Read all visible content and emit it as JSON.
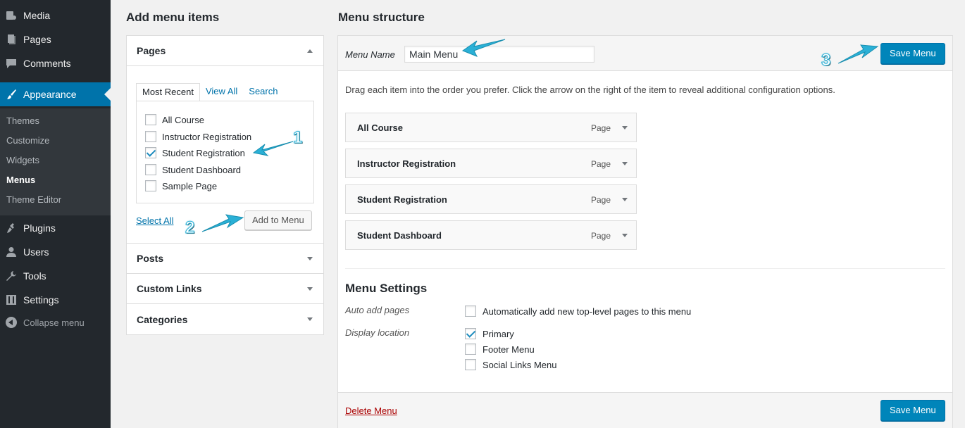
{
  "sidebar": {
    "items": [
      {
        "label": "Media",
        "icon": "media-icon"
      },
      {
        "label": "Pages",
        "icon": "pages-icon"
      },
      {
        "label": "Comments",
        "icon": "comments-icon"
      },
      {
        "label": "Appearance",
        "icon": "appearance-icon"
      },
      {
        "label": "Plugins",
        "icon": "plugins-icon"
      },
      {
        "label": "Users",
        "icon": "users-icon"
      },
      {
        "label": "Tools",
        "icon": "tools-icon"
      },
      {
        "label": "Settings",
        "icon": "settings-icon"
      }
    ],
    "submenu": [
      "Themes",
      "Customize",
      "Widgets",
      "Menus",
      "Theme Editor"
    ],
    "collapse_label": "Collapse menu"
  },
  "add_items": {
    "heading": "Add menu items",
    "pages": {
      "title": "Pages",
      "tabs": [
        "Most Recent",
        "View All",
        "Search"
      ],
      "items": [
        {
          "label": "All Course",
          "checked": false
        },
        {
          "label": "Instructor Registration",
          "checked": false
        },
        {
          "label": "Student Registration",
          "checked": true
        },
        {
          "label": "Student Dashboard",
          "checked": false
        },
        {
          "label": "Sample Page",
          "checked": false
        }
      ],
      "select_all": "Select All",
      "add_button": "Add to Menu"
    },
    "sections": [
      "Posts",
      "Custom Links",
      "Categories"
    ]
  },
  "structure": {
    "heading": "Menu structure",
    "menu_name_label": "Menu Name",
    "menu_name_value": "Main Menu",
    "save_label": "Save Menu",
    "instructions": "Drag each item into the order you prefer. Click the arrow on the right of the item to reveal additional configuration options.",
    "items": [
      {
        "title": "All Course",
        "type": "Page"
      },
      {
        "title": "Instructor Registration",
        "type": "Page"
      },
      {
        "title": "Student Registration",
        "type": "Page"
      },
      {
        "title": "Student Dashboard",
        "type": "Page"
      }
    ],
    "settings": {
      "title": "Menu Settings",
      "auto_add_label": "Auto add pages",
      "auto_add_option": "Automatically add new top-level pages to this menu",
      "display_label": "Display location",
      "locations": [
        {
          "label": "Primary",
          "checked": true
        },
        {
          "label": "Footer Menu",
          "checked": false
        },
        {
          "label": "Social Links Menu",
          "checked": false
        }
      ]
    },
    "delete_label": "Delete Menu"
  },
  "annotations": [
    "1",
    "2",
    "3"
  ],
  "colors": {
    "accent": "#0073aa",
    "primary_button": "#0085ba",
    "annotation": "#2ab0d6",
    "delete": "#a00000"
  }
}
